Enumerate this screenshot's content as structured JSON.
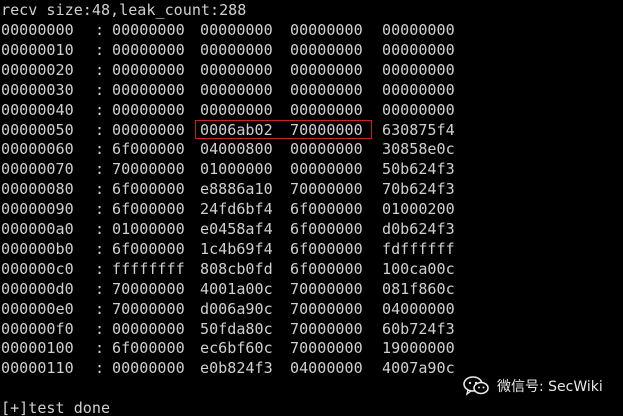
{
  "terminal": {
    "header": "recv size:48,leak_count:288",
    "rows": [
      {
        "addr": "00000000",
        "sep": ":",
        "words": [
          "00000000",
          "00000000",
          "00000000",
          "00000000"
        ]
      },
      {
        "addr": "00000010",
        "sep": ":",
        "words": [
          "00000000",
          "00000000",
          "00000000",
          "00000000"
        ]
      },
      {
        "addr": "00000020",
        "sep": ":",
        "words": [
          "00000000",
          "00000000",
          "00000000",
          "00000000"
        ]
      },
      {
        "addr": "00000030",
        "sep": ":",
        "words": [
          "00000000",
          "00000000",
          "00000000",
          "00000000"
        ]
      },
      {
        "addr": "00000040",
        "sep": ":",
        "words": [
          "00000000",
          "00000000",
          "00000000",
          "00000000"
        ]
      },
      {
        "addr": "00000050",
        "sep": ":",
        "words": [
          "00000000",
          "0006ab02",
          "70000000",
          "630875f4"
        ]
      },
      {
        "addr": "00000060",
        "sep": ":",
        "words": [
          "6f000000",
          "04000800",
          "00000000",
          "30858e0c"
        ]
      },
      {
        "addr": "00000070",
        "sep": ":",
        "words": [
          "70000000",
          "01000000",
          "00000000",
          "50b624f3"
        ]
      },
      {
        "addr": "00000080",
        "sep": ":",
        "words": [
          "6f000000",
          "e8886a10",
          "70000000",
          "70b624f3"
        ]
      },
      {
        "addr": "00000090",
        "sep": ":",
        "words": [
          "6f000000",
          "24fd6bf4",
          "6f000000",
          "01000200"
        ]
      },
      {
        "addr": "000000a0",
        "sep": ":",
        "words": [
          "01000000",
          "e0458af4",
          "6f000000",
          "d0b624f3"
        ]
      },
      {
        "addr": "000000b0",
        "sep": ":",
        "words": [
          "6f000000",
          "1c4b69f4",
          "6f000000",
          "fdffffff"
        ]
      },
      {
        "addr": "000000c0",
        "sep": ":",
        "words": [
          "ffffffff",
          "808cb0fd",
          "6f000000",
          "100ca00c"
        ]
      },
      {
        "addr": "000000d0",
        "sep": ":",
        "words": [
          "70000000",
          "4001a00c",
          "70000000",
          "081f860c"
        ]
      },
      {
        "addr": "000000e0",
        "sep": ":",
        "words": [
          "70000000",
          "d006a90c",
          "70000000",
          "04000000"
        ]
      },
      {
        "addr": "000000f0",
        "sep": ":",
        "words": [
          "00000000",
          "50fda80c",
          "70000000",
          "60b724f3"
        ]
      },
      {
        "addr": "00000100",
        "sep": ":",
        "words": [
          "6f000000",
          "ec6bf60c",
          "70000000",
          "19000000"
        ]
      },
      {
        "addr": "00000110",
        "sep": ":",
        "words": [
          "00000000",
          "e0b824f3",
          "04000000",
          "4007a90c"
        ]
      }
    ],
    "footer": "[+]test done"
  },
  "watermark": {
    "icon": "wechat-icon",
    "text": "微信号: SecWiki"
  },
  "colors": {
    "background": "#000000",
    "text": "#d0d0d0",
    "highlight": "#c8202a"
  }
}
